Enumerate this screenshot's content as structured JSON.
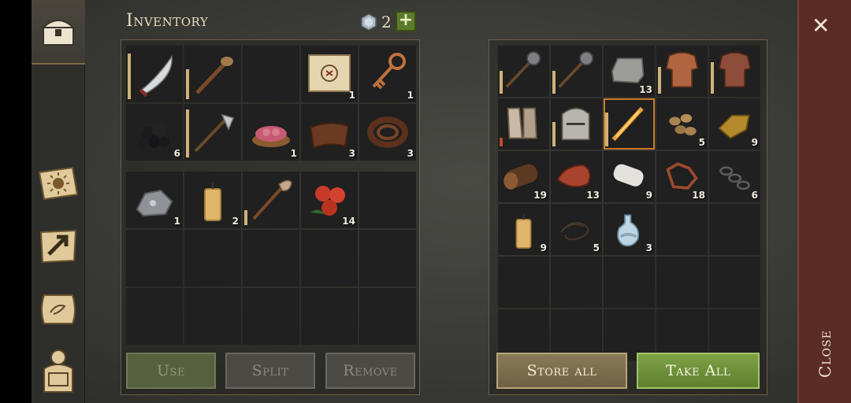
{
  "header": {
    "title": "Inventory",
    "gem_count": "2",
    "add_label": "+"
  },
  "inventory": {
    "top_slots": [
      {
        "icon": "scimitar-icon",
        "count": "",
        "durability": 0.9
      },
      {
        "icon": "torch-icon",
        "count": "",
        "durability": 0.6
      },
      {
        "icon": "empty",
        "count": ""
      },
      {
        "icon": "treasure-map-icon",
        "count": "1"
      },
      {
        "icon": "ornate-key-icon",
        "count": "1"
      },
      {
        "icon": "coal-icon",
        "count": "6"
      },
      {
        "icon": "halberd-icon",
        "count": "",
        "durability": 0.95
      },
      {
        "icon": "raw-meat-bowl-icon",
        "count": "1"
      },
      {
        "icon": "leather-icon",
        "count": "3"
      },
      {
        "icon": "leather-strap-icon",
        "count": "3"
      }
    ],
    "bottom_slots": [
      {
        "icon": "iron-ore-icon",
        "count": "1"
      },
      {
        "icon": "candle-icon",
        "count": "2"
      },
      {
        "icon": "shovel-icon",
        "count": "",
        "durability": 0.3
      },
      {
        "icon": "berries-icon",
        "count": "14"
      }
    ]
  },
  "buttons": {
    "use": "Use",
    "split": "Split",
    "remove": "Remove",
    "store_all": "Store all",
    "take_all": "Take All"
  },
  "chest": {
    "slots": [
      {
        "icon": "mace-icon",
        "count": "",
        "durability": 0.5
      },
      {
        "icon": "mace-icon",
        "count": "",
        "durability": 0.5
      },
      {
        "icon": "stone-block-icon",
        "count": "13"
      },
      {
        "icon": "leather-armor-icon",
        "count": "",
        "durability": 0.6
      },
      {
        "icon": "chainmail-icon",
        "count": "",
        "durability": 0.7
      },
      {
        "icon": "gauntlets-icon",
        "count": "",
        "durability": 0.2,
        "low": true
      },
      {
        "icon": "helmet-icon",
        "count": "",
        "durability": 0.55
      },
      {
        "icon": "fire-sword-icon",
        "count": "",
        "durability": 0.75,
        "selected": true
      },
      {
        "icon": "nuts-icon",
        "count": "5"
      },
      {
        "icon": "gold-ingot-icon",
        "count": "9"
      },
      {
        "icon": "log-icon",
        "count": "19"
      },
      {
        "icon": "steak-icon",
        "count": "13"
      },
      {
        "icon": "cloth-roll-icon",
        "count": "9"
      },
      {
        "icon": "copper-scrap-icon",
        "count": "18"
      },
      {
        "icon": "chain-icon",
        "count": "6"
      },
      {
        "icon": "candle-icon",
        "count": "9"
      },
      {
        "icon": "rope-icon",
        "count": "5"
      },
      {
        "icon": "potion-icon",
        "count": "3"
      }
    ]
  },
  "close_label": "Close",
  "sidebar": [
    "chest-icon",
    "recipe-book-icon",
    "map-arrow-icon",
    "scroll-icon",
    "backpack-icon"
  ]
}
